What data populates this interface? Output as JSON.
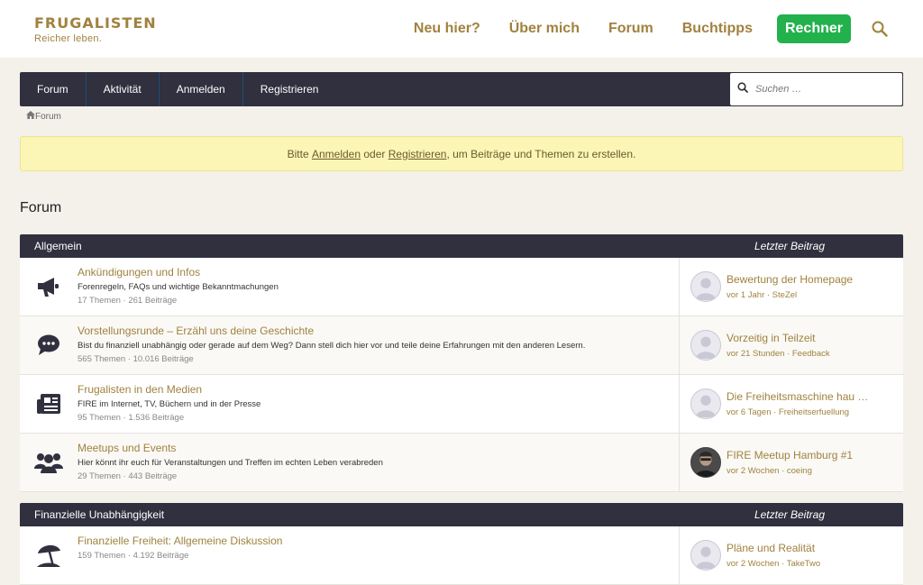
{
  "site": {
    "logo_title": "FRUGALISTEN",
    "logo_subtitle": "Reicher leben.",
    "nav": [
      "Neu hier?",
      "Über mich",
      "Forum",
      "Buchtipps"
    ],
    "cta": "Rechner"
  },
  "forum_nav": {
    "tabs": [
      "Forum",
      "Aktivität",
      "Anmelden",
      "Registrieren"
    ],
    "search_placeholder": "Suchen …"
  },
  "breadcrumb": {
    "home_label": "Forum"
  },
  "notice": {
    "prefix": "Bitte ",
    "login_link": "Anmelden",
    "middle": " oder ",
    "register_link": "Registrieren",
    "suffix": ", um Beiträge und Themen zu erstellen."
  },
  "page_title": "Forum",
  "categories": [
    {
      "name": "Allgemein",
      "last_label": "Letzter Beitrag",
      "nodes": [
        {
          "icon": "megaphone-icon",
          "title": "Ankündigungen und Infos",
          "desc": "Forenregeln, FAQs und wichtige Bekanntmachungen",
          "stats": "17 Themen · 261 Beiträge",
          "last_title": "Bewertung der Homepage",
          "last_meta": "vor 1 Jahr · SteZel"
        },
        {
          "icon": "chat-icon",
          "title": "Vorstellungsrunde – Erzähl uns deine Geschichte",
          "desc": "Bist du finanziell unabhängig oder gerade auf dem Weg? Dann stell dich hier vor und teile deine Erfahrungen mit den anderen Lesern.",
          "stats": "565 Themen · 10.016 Beiträge",
          "last_title": "Vorzeitig in Teilzeit",
          "last_meta": "vor 21 Stunden · Feedback"
        },
        {
          "icon": "newspaper-icon",
          "title": "Frugalisten in den Medien",
          "desc": "FIRE im Internet, TV, Büchern und in der Presse",
          "stats": "95 Themen · 1.536 Beiträge",
          "last_title": "Die Freiheitsmaschine hau …",
          "last_meta": "vor 6 Tagen · Freiheitserfuellung"
        },
        {
          "icon": "users-icon",
          "title": "Meetups und Events",
          "desc": "Hier könnt ihr euch für Veranstaltungen und Treffen im echten Leben verabreden",
          "stats": "29 Themen · 443 Beiträge",
          "last_title": "FIRE Meetup Hamburg #1",
          "last_meta": "vor 2 Wochen · coeing"
        }
      ]
    },
    {
      "name": "Finanzielle Unabhängigkeit",
      "last_label": "Letzter Beitrag",
      "nodes": [
        {
          "icon": "beach-umbrella-icon",
          "title": "Finanzielle Freiheit: Allgemeine Diskussion",
          "desc": "",
          "stats": "159 Themen · 4.192 Beiträge",
          "last_title": "Pläne und Realität",
          "last_meta": "vor 2 Wochen · TakeTwo"
        }
      ]
    }
  ]
}
